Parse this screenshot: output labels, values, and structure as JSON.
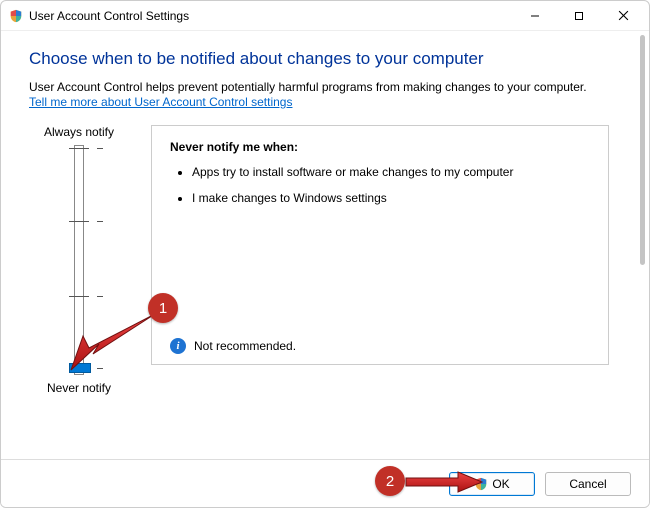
{
  "titlebar": {
    "title": "User Account Control Settings"
  },
  "heading": "Choose when to be notified about changes to your computer",
  "description": "User Account Control helps prevent potentially harmful programs from making changes to your computer.",
  "learn_more": "Tell me more about User Account Control settings",
  "slider": {
    "top_label": "Always notify",
    "bottom_label": "Never notify",
    "level": 0
  },
  "panel": {
    "title": "Never notify me when:",
    "bullets": [
      "Apps try to install software or make changes to my computer",
      "I make changes to Windows settings"
    ],
    "footer_text": "Not recommended."
  },
  "buttons": {
    "ok": "OK",
    "cancel": "Cancel"
  },
  "annotations": {
    "one": "1",
    "two": "2"
  }
}
